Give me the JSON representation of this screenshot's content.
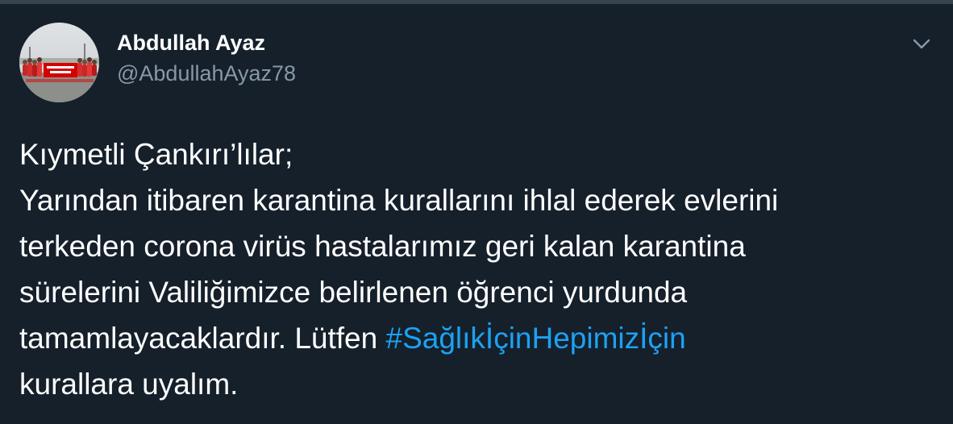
{
  "tweet": {
    "author": {
      "display_name": "Abdullah Ayaz",
      "handle": "@AbdullahAyaz78",
      "avatar_icon": "group-photo-avatar"
    },
    "menu_icon": "chevron-down-icon",
    "text_lines": [
      "Kıymetli Çankırı’lılar;",
      "Yarından itibaren karantina kurallarını ihlal ederek evlerini",
      "terkeden corona virüs hastalarımız geri kalan karantina",
      "sürelerini Valiliğimizce belirlenen öğrenci yurdunda"
    ],
    "line5_prefix": "tamamlayacaklardır. Lütfen ",
    "hashtag": "#SağlıkİçinHepimizİçin",
    "line6": "kurallara uyalım."
  },
  "colors": {
    "background": "#15202b",
    "text": "#ffffff",
    "secondary_text": "#8899a6",
    "link": "#1da1f2"
  }
}
